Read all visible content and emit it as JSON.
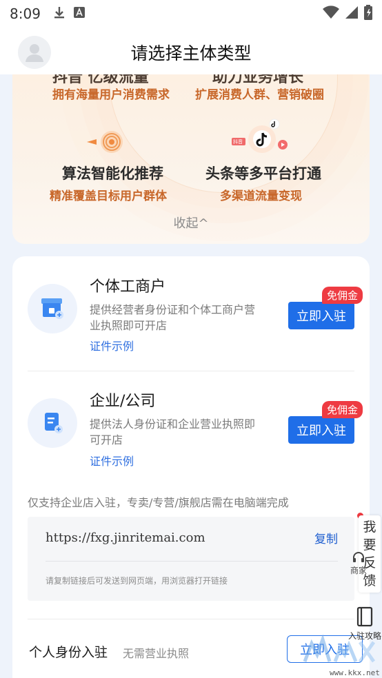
{
  "status_bar": {
    "time": "8:09"
  },
  "header": {
    "title": "请选择主体类型"
  },
  "promo": {
    "cut_titles": [
      "抖音  亿级流量",
      "助力业务增长"
    ],
    "items": [
      {
        "subtitle": "拥有海量用户消费需求"
      },
      {
        "subtitle": "扩展消费人群、营销破圈"
      },
      {
        "title": "算法智能化推荐",
        "subtitle": "精准覆盖目标用户群体"
      },
      {
        "title": "头条等多平台打通",
        "subtitle": "多渠道流量变现"
      }
    ],
    "collapse_label": "收起^",
    "icon_tag": "抖音"
  },
  "entities": [
    {
      "title": "个体工商户",
      "desc": "提供经营者身份证和个体工商户营业执照即可开店",
      "link": "证件示例",
      "button": "立即入驻",
      "badge": "免佣金"
    },
    {
      "title": "企业/公司",
      "desc": "提供法人身份证和企业营业执照即可开店",
      "link": "证件示例",
      "button": "立即入驻",
      "badge": "免佣金"
    }
  ],
  "note": "仅支持企业店入驻，专卖/专营/旗舰店需在电脑端完成",
  "url_box": {
    "url": "https://fxg.jinritemai.com",
    "copy": "复制",
    "hint": "请复制链接后可发送到网页端，用浏览器打开链接"
  },
  "personal": {
    "label": "个人身份入驻",
    "sub": "无需营业执照",
    "button": "立即入驻"
  },
  "floating": {
    "feedback_chars": [
      "我",
      "要",
      "反",
      "馈"
    ],
    "merchant_label": "商家",
    "guide_label": "入驻攻略"
  },
  "watermark": {
    "text": "www.kkx.net"
  },
  "colors": {
    "primary": "#1f6ee8",
    "badge": "#ee3b42",
    "promo_orange": "#c8672a"
  }
}
